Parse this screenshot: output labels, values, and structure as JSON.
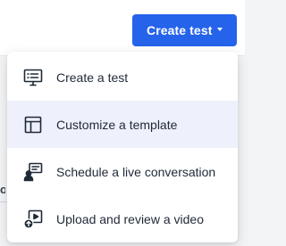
{
  "header": {
    "create_button_label": "Create test"
  },
  "menu": {
    "items": [
      {
        "label": "Create a test",
        "icon": "monitor-checklist-icon"
      },
      {
        "label": "Customize a template",
        "icon": "template-layout-icon",
        "highlighted": true
      },
      {
        "label": "Schedule a live conversation",
        "icon": "live-conversation-icon"
      },
      {
        "label": "Upload and review a video",
        "icon": "video-upload-icon"
      }
    ]
  },
  "colors": {
    "primary": "#2563eb",
    "highlight": "#eef0fb",
    "text": "#1f2937",
    "icon": "#1f2937"
  }
}
